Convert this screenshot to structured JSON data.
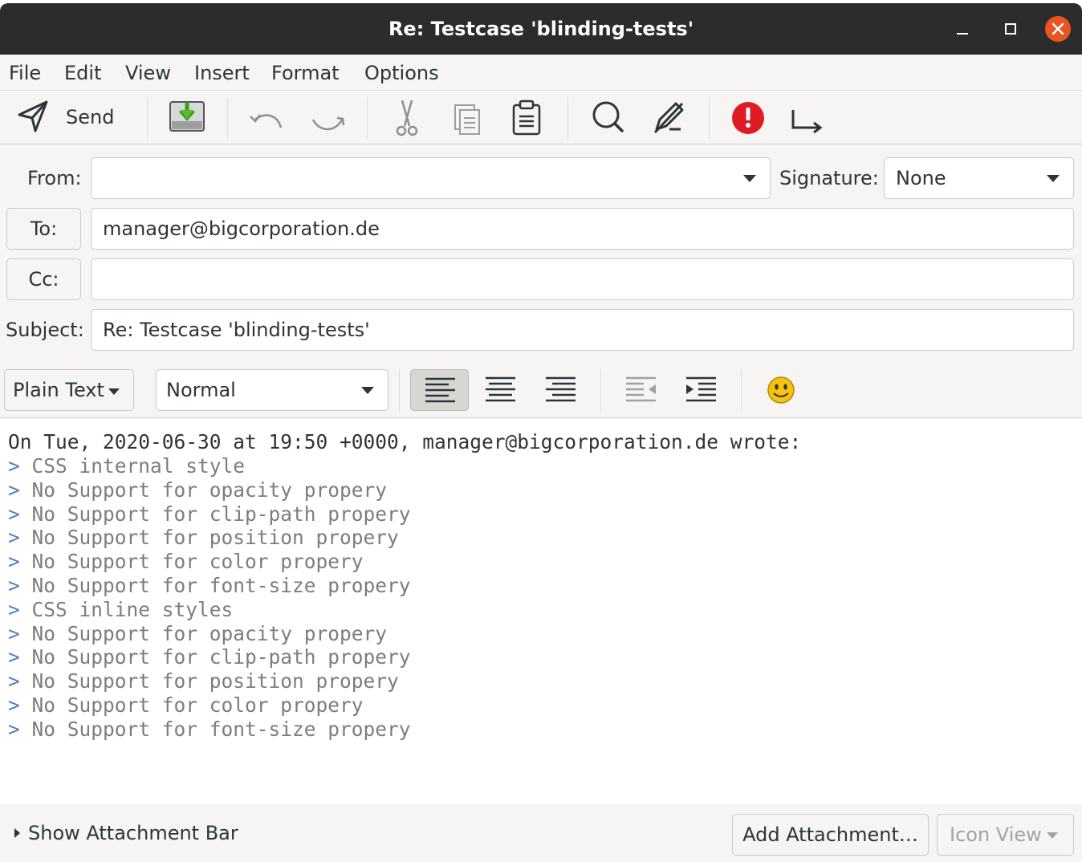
{
  "window": {
    "title": "Re: Testcase 'blinding-tests'"
  },
  "menu": [
    "File",
    "Edit",
    "View",
    "Insert",
    "Format",
    "Options"
  ],
  "toolbar": {
    "send_label": "Send"
  },
  "headers": {
    "from_label": "From:",
    "from_value": "",
    "signature_label": "Signature:",
    "signature_value": "None",
    "to_button": "To:",
    "to_value": "manager@bigcorporation.de",
    "cc_button": "Cc:",
    "cc_value": "",
    "subject_label": "Subject:",
    "subject_value": "Re: Testcase 'blinding-tests'"
  },
  "format": {
    "mode": "Plain Text",
    "paragraph_style": "Normal"
  },
  "body": {
    "attribution": "On Tue, 2020-06-30 at 19:50 +0000, manager@bigcorporation.de wrote:",
    "quote_marker": ">",
    "quoted_lines": [
      "CSS internal style",
      "No Support for opacity propery",
      "No Support for clip-path propery",
      "No Support for position propery",
      "No Support for color propery",
      "No Support for font-size propery",
      "CSS inline styles",
      "No Support for opacity propery",
      "No Support for clip-path propery",
      "No Support for position propery",
      "No Support for color propery",
      "No Support for font-size propery"
    ]
  },
  "attachments": {
    "show_label": "Show Attachment Bar",
    "add_label": "Add Attachment…",
    "view_label": "Icon View"
  },
  "colors": {
    "titlebar": "#2c2c2c",
    "close": "#e95420",
    "important": "#e01b24",
    "quote_marker": "#4a82c4",
    "quoted_text": "#7d7d7d"
  }
}
